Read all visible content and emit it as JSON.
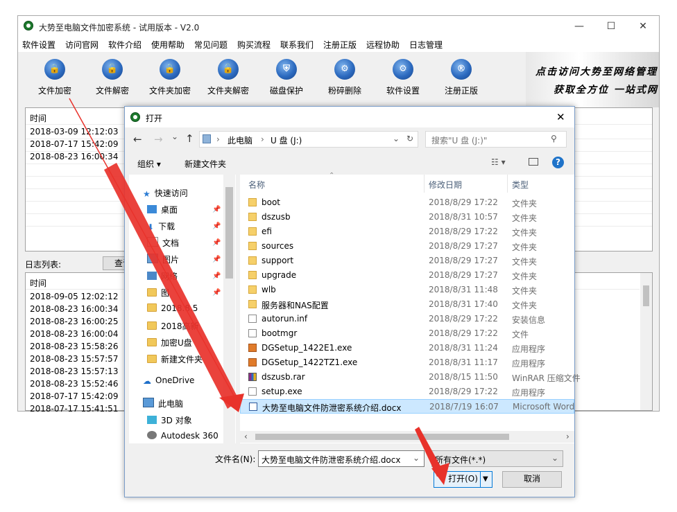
{
  "app": {
    "title": "大势至电脑文件加密系统 - 试用版本 - V2.0",
    "window_controls": {
      "minimize": "—",
      "maximize": "☐",
      "close": "✕"
    },
    "menu": [
      "软件设置",
      "访问官网",
      "软件介绍",
      "使用帮助",
      "常见问题",
      "购买流程",
      "联系我们",
      "注册正版",
      "远程协助",
      "日志管理"
    ],
    "toolbar": [
      {
        "label": "文件加密",
        "icon": "file-lock-icon",
        "glyph": "🔒"
      },
      {
        "label": "文件解密",
        "icon": "file-unlock-icon",
        "glyph": "🔓"
      },
      {
        "label": "文件夹加密",
        "icon": "folder-lock-icon",
        "glyph": "🔒"
      },
      {
        "label": "文件夹解密",
        "icon": "folder-unlock-icon",
        "glyph": "🔓"
      },
      {
        "label": "磁盘保护",
        "icon": "disk-shield-icon",
        "glyph": "⛨"
      },
      {
        "label": "粉碎删除",
        "icon": "shred-icon",
        "glyph": "⚙"
      },
      {
        "label": "软件设置",
        "icon": "gear-icon",
        "glyph": "⚙"
      },
      {
        "label": "注册正版",
        "icon": "registered-icon",
        "glyph": "®"
      }
    ],
    "banner": {
      "line1": "点击访问大势至网络管理",
      "line2": "获取全方位 一站式网"
    },
    "top_table": {
      "header": "时间",
      "rows": [
        "2018-03-09 12:12:03",
        "2018-07-17 15:42:09",
        "2018-08-23 16:00:34"
      ]
    },
    "log_list": {
      "label": "日志列表:",
      "query_button": "查询",
      "header": "时间",
      "rows": [
        "2018-09-05 12:02:12",
        "2018-08-23 16:00:34",
        "2018-08-23 16:00:25",
        "2018-08-23 16:00:04",
        "2018-08-23 15:58:26",
        "2018-08-23 15:57:57",
        "2018-08-23 15:57:13",
        "2018-08-23 15:52:46",
        "2018-07-17 15:42:09",
        "2018-07-17 15:41:51"
      ]
    }
  },
  "dialog": {
    "title": "打开",
    "close": "✕",
    "nav": {
      "back": "←",
      "forward": "→",
      "dropdown": "⌄",
      "up": "↑"
    },
    "breadcrumb": [
      "此电脑",
      "U 盘 (J:)"
    ],
    "refresh": "↻",
    "search_placeholder": "搜索\"U 盘 (J:)\"",
    "organize": "组织 ▾",
    "new_folder": "新建文件夹",
    "help": "?",
    "sidebar": [
      {
        "label": "快速访问",
        "icon": "star-icon",
        "pinned": false
      },
      {
        "label": "桌面",
        "icon": "desktop-icon",
        "pinned": true
      },
      {
        "label": "下载",
        "icon": "download-icon",
        "pinned": true
      },
      {
        "label": "文档",
        "icon": "document-icon",
        "pinned": true
      },
      {
        "label": "图片",
        "icon": "picture-icon",
        "pinned": true
      },
      {
        "label": "网络",
        "icon": "network-icon",
        "pinned": true
      },
      {
        "label": "图",
        "icon": "folder-icon",
        "pinned": true
      },
      {
        "label": "2018.8.5",
        "icon": "folder-icon",
        "pinned": false
      },
      {
        "label": "2018高新",
        "icon": "folder-icon",
        "pinned": false
      },
      {
        "label": "加密U盘",
        "icon": "folder-icon",
        "pinned": false
      },
      {
        "label": "新建文件夹",
        "icon": "folder-icon",
        "pinned": false
      },
      {
        "label": "OneDrive",
        "icon": "cloud-icon",
        "pinned": false
      },
      {
        "label": "此电脑",
        "icon": "computer-icon",
        "pinned": false
      },
      {
        "label": "3D 对象",
        "icon": "cube-icon",
        "pinned": false
      },
      {
        "label": "Autodesk 360",
        "icon": "autodesk-icon",
        "pinned": false
      }
    ],
    "columns": {
      "name": "名称",
      "date": "修改日期",
      "type": "类型"
    },
    "files": [
      {
        "name": "boot",
        "date": "2018/8/29 17:22",
        "type": "文件夹",
        "kind": "folder"
      },
      {
        "name": "dszusb",
        "date": "2018/8/31 10:57",
        "type": "文件夹",
        "kind": "folder"
      },
      {
        "name": "efi",
        "date": "2018/8/29 17:22",
        "type": "文件夹",
        "kind": "folder"
      },
      {
        "name": "sources",
        "date": "2018/8/29 17:27",
        "type": "文件夹",
        "kind": "folder"
      },
      {
        "name": "support",
        "date": "2018/8/29 17:27",
        "type": "文件夹",
        "kind": "folder"
      },
      {
        "name": "upgrade",
        "date": "2018/8/29 17:27",
        "type": "文件夹",
        "kind": "folder"
      },
      {
        "name": "wlb",
        "date": "2018/8/31 11:48",
        "type": "文件夹",
        "kind": "folder"
      },
      {
        "name": "服务器和NAS配置",
        "date": "2018/8/31 17:40",
        "type": "文件夹",
        "kind": "folder"
      },
      {
        "name": "autorun.inf",
        "date": "2018/8/29 17:22",
        "type": "安装信息",
        "kind": "file"
      },
      {
        "name": "bootmgr",
        "date": "2018/8/29 17:22",
        "type": "文件",
        "kind": "file"
      },
      {
        "name": "DGSetup_1422E1.exe",
        "date": "2018/8/31 11:24",
        "type": "应用程序",
        "kind": "exe"
      },
      {
        "name": "DGSetup_1422TZ1.exe",
        "date": "2018/8/31 11:17",
        "type": "应用程序",
        "kind": "exe"
      },
      {
        "name": "dszusb.rar",
        "date": "2018/8/15 11:50",
        "type": "WinRAR 压缩文件",
        "kind": "rar"
      },
      {
        "name": "setup.exe",
        "date": "2018/8/29 17:22",
        "type": "应用程序",
        "kind": "file"
      },
      {
        "name": "大势至电脑文件防泄密系统介绍.docx",
        "date": "2018/7/19 16:07",
        "type": "Microsoft Word",
        "kind": "doc",
        "selected": true
      }
    ],
    "filename_label": "文件名(N):",
    "filename_value": "大势至电脑文件防泄密系统介绍.docx",
    "filetype_value": "所有文件(*.*)",
    "open_button": "打开(O)",
    "cancel_button": "取消"
  },
  "colors": {
    "arrow": "#e8322b",
    "selection": "#cce8ff",
    "accent": "#0078d7"
  }
}
